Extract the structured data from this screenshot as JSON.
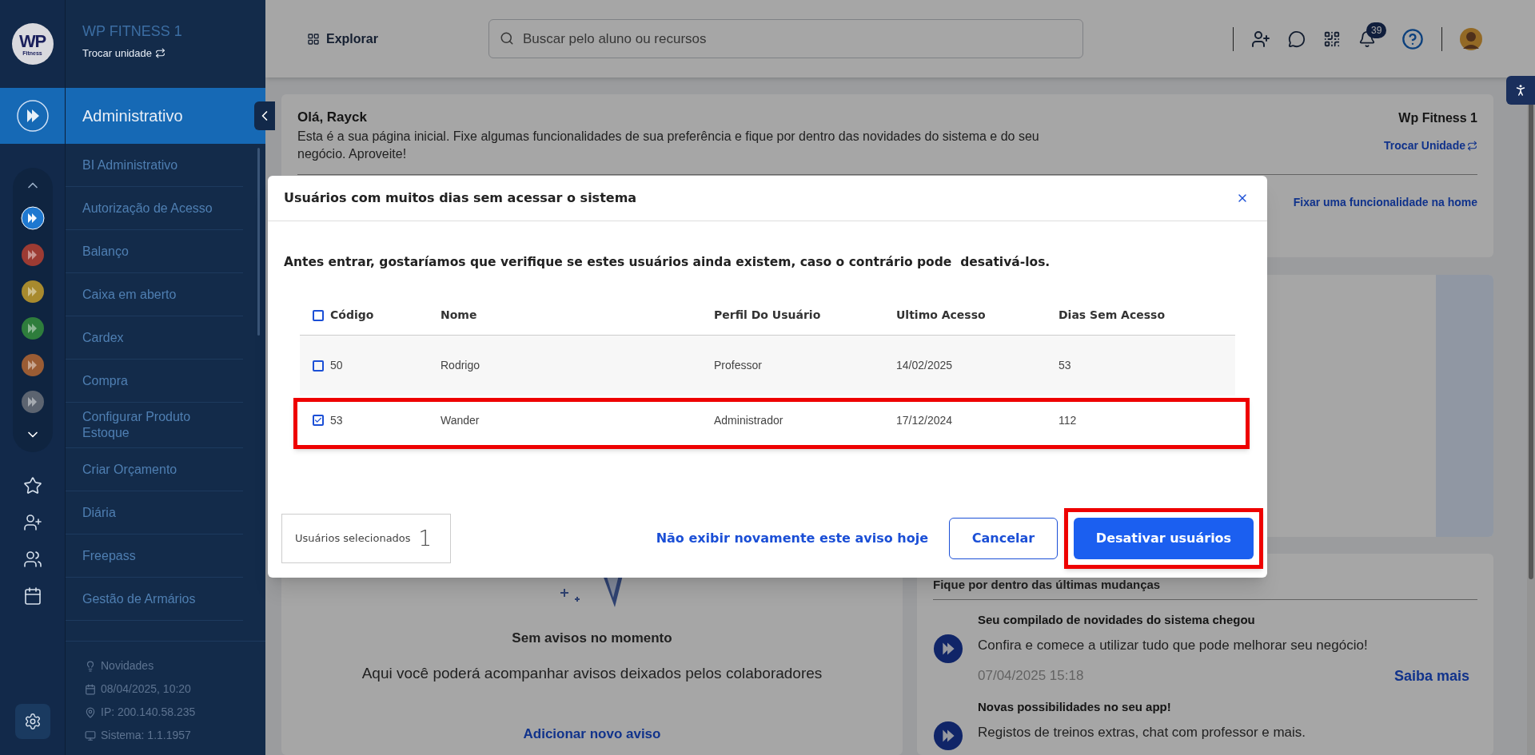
{
  "sidebar": {
    "logo": {
      "title": "WP",
      "subtitle": "Fitness"
    },
    "unit_name": "WP FITNESS 1",
    "switch_unit": "Trocar unidade",
    "module_title": "Administrativo",
    "modules": [
      {
        "color": "#1e78d0",
        "selected": true
      },
      {
        "color": "#9c3b33",
        "selected": false
      },
      {
        "color": "#a88a2e",
        "selected": false
      },
      {
        "color": "#2e7d3c",
        "selected": false
      },
      {
        "color": "#9a5c34",
        "selected": false
      },
      {
        "color": "#5c6470",
        "selected": false
      }
    ],
    "items": [
      {
        "label": "BI Administrativo"
      },
      {
        "label": "Autorização de Acesso"
      },
      {
        "label": "Balanço"
      },
      {
        "label": "Caixa em aberto"
      },
      {
        "label": "Cardex"
      },
      {
        "label": "Compra"
      },
      {
        "label": "Configurar Produto Estoque"
      },
      {
        "label": "Criar Orçamento"
      },
      {
        "label": "Diária"
      },
      {
        "label": "Freepass"
      },
      {
        "label": "Gestão de Armários"
      }
    ],
    "footer": [
      {
        "kind": "news",
        "text": "Novidades"
      },
      {
        "kind": "date",
        "text": "08/04/2025, 10:20"
      },
      {
        "kind": "ip",
        "text": "IP: 200.140.58.235"
      },
      {
        "kind": "system",
        "text": "Sistema: 1.1.1957"
      }
    ]
  },
  "topbar": {
    "explore": "Explorar",
    "search": {
      "placeholder": "Buscar pelo aluno ou recursos"
    },
    "notifications": "39"
  },
  "welcome": {
    "greeting": "Olá, Rayck",
    "text": "Esta é a sua página inicial. Fixe algumas funcionalidades de sua preferência e fique por dentro das novidades do sistema e do seu negócio. Aproveite!",
    "unit": "Wp Fitness 1",
    "switch_unit": "Trocar Unidade",
    "pin": "Fixar uma funcionalidade na home"
  },
  "notices": {
    "title": "Sem avisos no momento",
    "text": "Aqui você poderá acompanhar avisos deixados pelos colaboradores",
    "add": "Adicionar novo aviso"
  },
  "updates": {
    "title": "Fique por dentro das últimas mudanças",
    "items": [
      {
        "title": "Seu compilado de novidades do sistema chegou",
        "text": "Confira e comece a utilizar tudo que pode melhorar seu negócio!",
        "date": "07/04/2025 15:18",
        "link": "Saiba mais"
      },
      {
        "title": "Novas possibilidades no seu app!",
        "text": "Registos de treinos extras, chat com professor e mais."
      }
    ]
  },
  "modal": {
    "title": "Usuários com muitos dias sem acessar o sistema",
    "intro": "Antes entrar, gostaríamos que verifique se estes usuários ainda existem, caso o contrário pode  desativá-los.",
    "all_checked": false,
    "columns": [
      "Código",
      "Nome",
      "Perfil Do Usuário",
      "Ultimo Acesso",
      "Dias Sem Acesso"
    ],
    "rows": [
      {
        "cells": [
          "50",
          "Rodrigo",
          "Professor",
          "14/02/2025",
          "53"
        ],
        "checked": false,
        "highlighted": false
      },
      {
        "cells": [
          "53",
          "Wander",
          "Administrador",
          "17/12/2024",
          "112"
        ],
        "checked": true,
        "highlighted": true
      }
    ],
    "selected_label": "Usuários selecionados",
    "selected_count": "1",
    "dismiss": "Não exibir novamente este aviso hoje",
    "cancel": "Cancelar",
    "confirm": "Desativar usuários",
    "confirm_highlighted": true
  }
}
